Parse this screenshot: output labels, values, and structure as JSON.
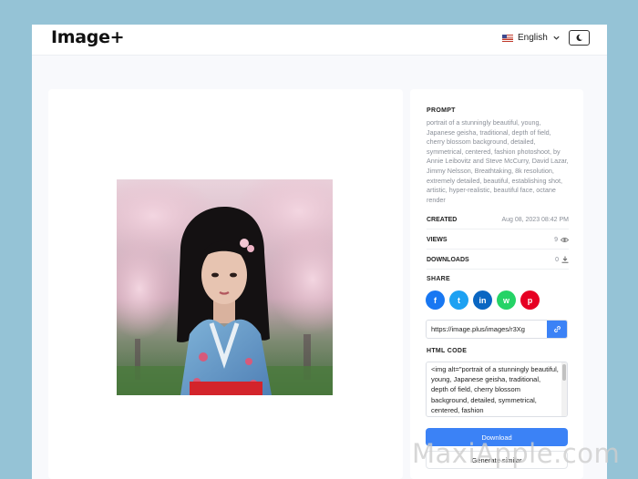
{
  "header": {
    "logo": "Image+",
    "language": "English",
    "flag_icon": "us-flag-icon",
    "theme_icon": "moon-icon"
  },
  "image": {
    "alt": "portrait of a stunningly beautiful, young, Japanese geisha, traditional, depth of field, cherry blossom background"
  },
  "details": {
    "prompt_label": "PROMPT",
    "prompt_text": "portrait of a stunningly beautiful, young, Japanese geisha, traditional, depth of field, cherry blossom background, detailed, symmetrical, centered, fashion photoshoot, by Annie Leibovitz and Steve McCurry, David Lazar, Jimmy Nelsson, Breathtaking, 8k resolution, extremely detailed, beautiful, establishing shot, artistic, hyper-realistic, beautiful face, octane render",
    "created_label": "CREATED",
    "created_value": "Aug 08, 2023 08:42 PM",
    "views_label": "VIEWS",
    "views_value": "9",
    "downloads_label": "DOWNLOADS",
    "downloads_value": "0",
    "share_label": "SHARE",
    "share_buttons": [
      {
        "name": "facebook",
        "glyph": "f",
        "color": "#1877f2"
      },
      {
        "name": "twitter",
        "glyph": "t",
        "color": "#1da1f2"
      },
      {
        "name": "linkedin",
        "glyph": "in",
        "color": "#0a66c2"
      },
      {
        "name": "whatsapp",
        "glyph": "w",
        "color": "#25d366"
      },
      {
        "name": "pinterest",
        "glyph": "p",
        "color": "#e60023"
      }
    ],
    "share_url": "https://image.plus/images/r3Xg",
    "html_code_label": "HTML CODE",
    "html_code": "<img alt=\"portrait of a stunningly beautiful, young, Japanese geisha, traditional, depth of field, cherry blossom background, detailed, symmetrical, centered, fashion",
    "download_label": "Download",
    "generate_label": "Generate similar"
  },
  "watermark": "MaxiApple.com",
  "colors": {
    "accent": "#3b82f6",
    "backdrop": "#95c3d6"
  }
}
